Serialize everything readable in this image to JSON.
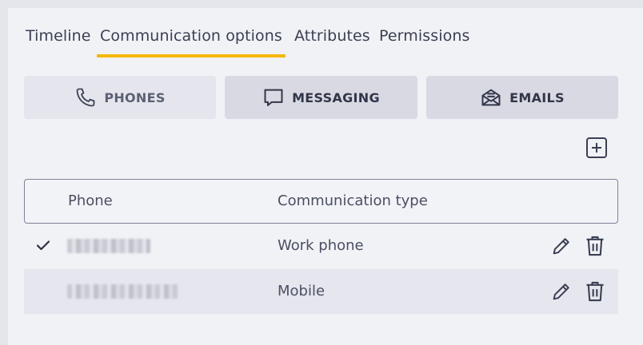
{
  "tabs": [
    {
      "label": "Timeline"
    },
    {
      "label": "Communication options",
      "active": true
    },
    {
      "label": "Attributes"
    },
    {
      "label": "Permissions"
    }
  ],
  "channels": {
    "phones": {
      "label": "PHONES",
      "icon": "phone-icon"
    },
    "messaging": {
      "label": "MESSAGING",
      "icon": "message-icon"
    },
    "emails": {
      "label": "EMAILS",
      "icon": "envelope-icon"
    }
  },
  "table": {
    "columns": {
      "phone": "Phone",
      "type": "Communication type"
    },
    "rows": [
      {
        "selected": true,
        "phone": "",
        "type": "Work phone"
      },
      {
        "selected": false,
        "phone": "",
        "type": "Mobile"
      }
    ]
  },
  "colors": {
    "accent": "#f5b700",
    "background": "#f1f2f6",
    "text": "#3a3f52"
  }
}
